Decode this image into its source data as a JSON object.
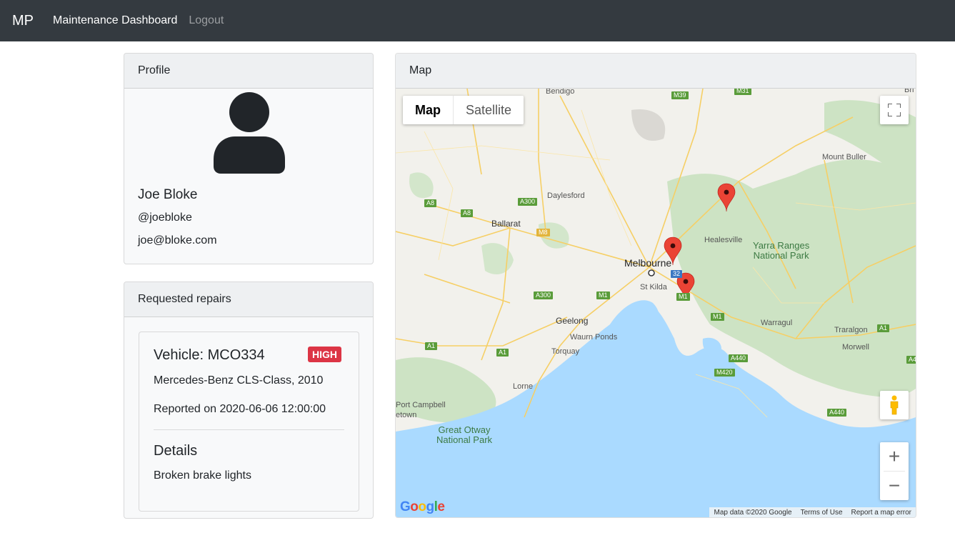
{
  "navbar": {
    "brand": "MP",
    "links": [
      {
        "label": "Maintenance Dashboard"
      },
      {
        "label": "Logout"
      }
    ]
  },
  "profile": {
    "header": "Profile",
    "name": "Joe Bloke",
    "handle": "@joebloke",
    "email": "joe@bloke.com",
    "avatar_icon": "user-icon"
  },
  "repairs": {
    "header": "Requested repairs",
    "items": [
      {
        "vehicle": "Vehicle: MCO334",
        "priority": "HIGH",
        "priority_color": "#dc3545",
        "model": "Mercedes-Benz CLS-Class, 2010",
        "reported": "Reported on 2020-06-06 12:00:00",
        "details_title": "Details",
        "details": "Broken brake lights"
      }
    ]
  },
  "map": {
    "header": "Map",
    "map_type_buttons": [
      "Map",
      "Satellite"
    ],
    "selected_map_type": "Map",
    "places": {
      "bendigo": "Bendigo",
      "daylesford": "Daylesford",
      "ballarat": "Ballarat",
      "melbourne": "Melbourne",
      "stkilda": "St Kilda",
      "healesville": "Healesville",
      "mountbuller": "Mount Buller",
      "geelong": "Geelong",
      "waurnponds": "Waurn Ponds",
      "torquay": "Torquay",
      "lorne": "Lorne",
      "warragul": "Warragul",
      "traralgon": "Traralgon",
      "morwell": "Morwell",
      "portcampbell": "Port Campbell",
      "etown": "etown",
      "bri": "Bri"
    },
    "parks": {
      "yarra": [
        "Yarra Ranges",
        "National Park"
      ],
      "otway": [
        "Great Otway",
        "National Park"
      ]
    },
    "road_shields": {
      "m39": "M39",
      "m31": "M31",
      "a300a": "A300",
      "a8a": "A8",
      "a8b": "A8",
      "m8": "M8",
      "a300b": "A300",
      "m1a": "M1",
      "r32": "32",
      "m1b": "M1",
      "m1c": "M1",
      "a1a": "A1",
      "a1b": "A1",
      "a1c": "A1",
      "a440a": "A440",
      "m420": "M420",
      "a440b": "A440",
      "a4": "A4"
    },
    "markers": 3,
    "marker_color": "#ea4335",
    "google_logo": "Google",
    "footer": [
      "Map data ©2020 Google",
      "Terms of Use",
      "Report a map error"
    ],
    "icons": {
      "fullscreen": "fullscreen-icon",
      "pegman": "pegman-icon",
      "zoom_in": "+",
      "zoom_out": "−"
    }
  }
}
